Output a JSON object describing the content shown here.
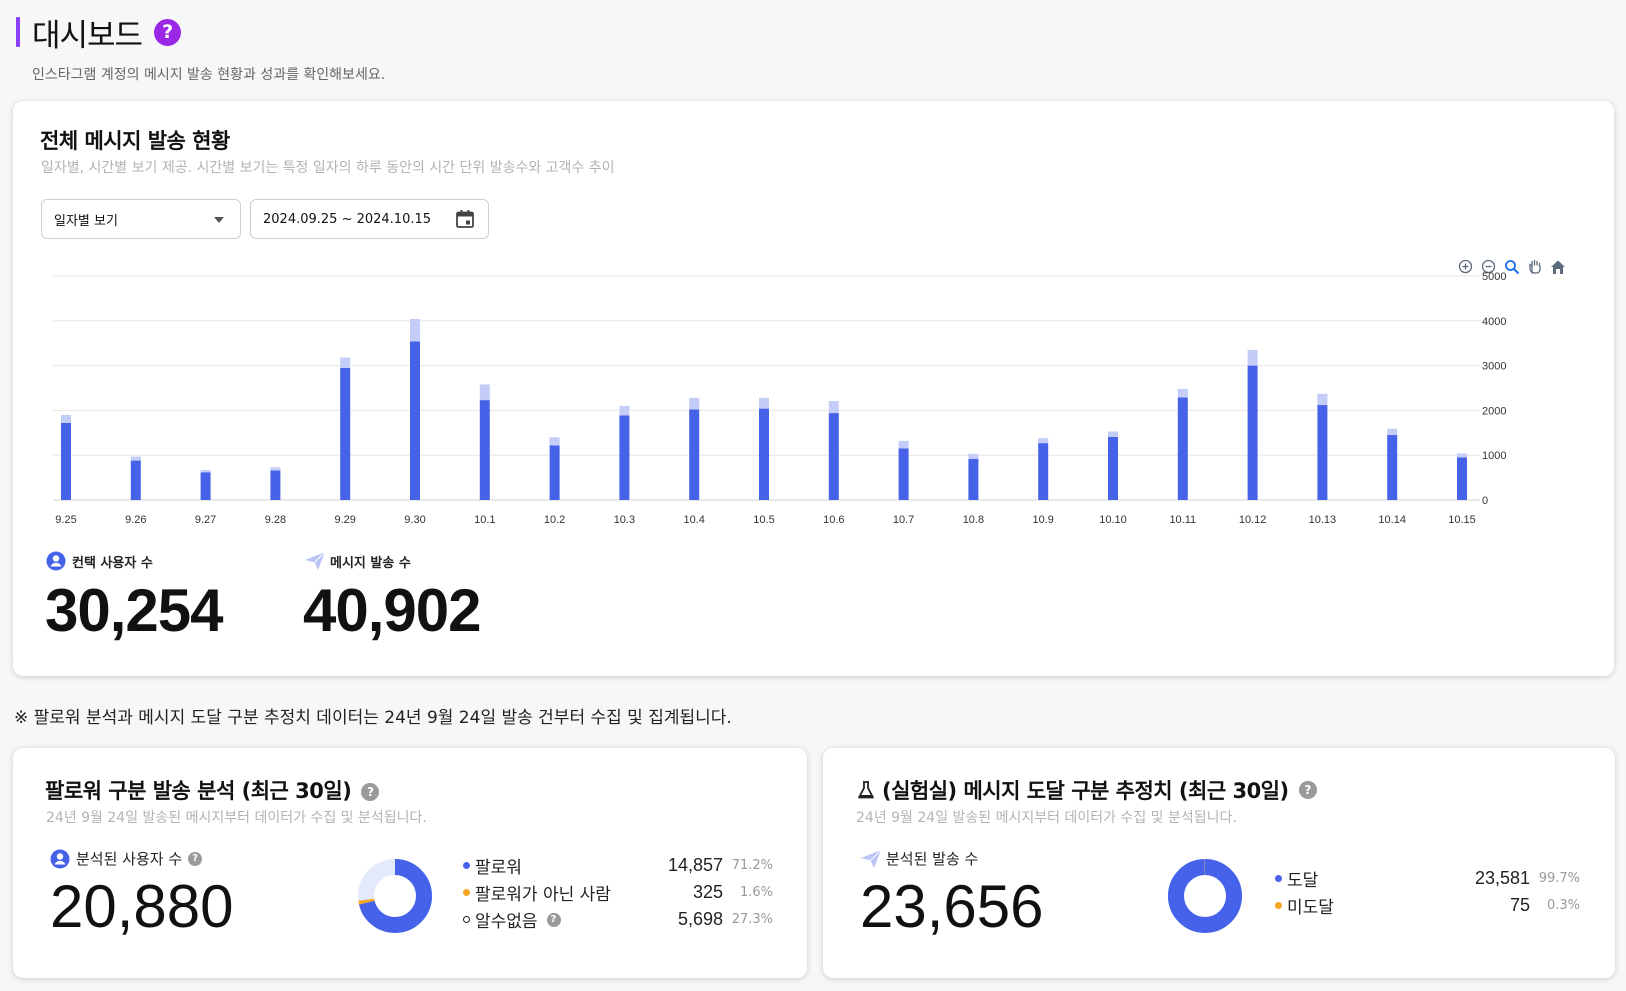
{
  "header": {
    "title": "대시보드",
    "help_icon": "question-circle-icon",
    "subtitle": "인스타그램 계정의 메시지 발송 현황과 성과를 확인해보세요."
  },
  "main_card": {
    "title": "전체 메시지 발송 현황",
    "description": "일자별, 시간별 보기 제공. 시간별 보기는 특정 일자의 하루 동안의 시간 단위 발송수와 고객수 추이",
    "view_select": {
      "value": "일자별 보기"
    },
    "date_range": {
      "value": "2024.09.25 ~ 2024.10.15"
    },
    "toolbar_icons": [
      "zoom-in-icon",
      "zoom-out-icon",
      "zoom-select-icon",
      "pan-hand-icon",
      "home-reset-icon"
    ],
    "kpis": [
      {
        "label": "컨택 사용자 수",
        "value": "30,254",
        "icon": "user-circle-icon"
      },
      {
        "label": "메시지 발송 수",
        "value": "40,902",
        "icon": "paper-plane-icon"
      }
    ]
  },
  "chart_data": {
    "type": "bar",
    "stacked": true,
    "categories": [
      "9.25",
      "9.26",
      "9.27",
      "9.28",
      "9.29",
      "9.30",
      "10.1",
      "10.2",
      "10.3",
      "10.4",
      "10.5",
      "10.6",
      "10.7",
      "10.8",
      "10.9",
      "10.10",
      "10.11",
      "10.12",
      "10.13",
      "10.14",
      "10.15"
    ],
    "series": [
      {
        "color": "#4662e8",
        "values": [
          1720,
          880,
          620,
          660,
          2950,
          3540,
          2230,
          1220,
          1890,
          2020,
          2040,
          1940,
          1150,
          920,
          1270,
          1410,
          2290,
          3000,
          2120,
          1450,
          950
        ]
      },
      {
        "color": "#c3cdf8",
        "values": [
          180,
          90,
          50,
          70,
          230,
          500,
          350,
          180,
          210,
          260,
          240,
          270,
          170,
          110,
          110,
          120,
          190,
          350,
          250,
          140,
          90
        ]
      }
    ],
    "ylim": [
      0,
      5000
    ],
    "yticks": [
      0,
      1000,
      2000,
      3000,
      4000,
      5000
    ],
    "y_axis_side": "right",
    "grid": true
  },
  "notice": "※ 팔로워 분석과 메시지 도달 구분 추정치 데이터는 24년 9월 24일 발송 건부터 수집 및 집계됩니다.",
  "follower_card": {
    "title": "팔로워 구분 발송 분석 (최근 30일)",
    "description": "24년 9월 24일 발송된 메시지부터 데이터가 수집 및 분석됩니다.",
    "metric_label": "분석된 사용자 수",
    "metric_value": "20,880",
    "legend": [
      {
        "label": "팔로워",
        "value": "14,857",
        "pct": "71.2%",
        "color": "#4662e8",
        "share": 0.712
      },
      {
        "label": "팔로워가 아닌 사람",
        "value": "325",
        "pct": "1.6%",
        "color": "#f5a623",
        "share": 0.016
      },
      {
        "label": "알수없음",
        "value": "5,698",
        "pct": "27.3%",
        "color": "#e4e9fb",
        "share": 0.273
      }
    ]
  },
  "delivery_card": {
    "title": "(실험실) 메시지 도달 구분 추정치 (최근 30일)",
    "title_icon": "flask-icon",
    "description": "24년 9월 24일 발송된 메시지부터 데이터가 수집 및 분석됩니다.",
    "metric_label": "분석된 발송 수",
    "metric_value": "23,656",
    "legend": [
      {
        "label": "도달",
        "value": "23,581",
        "pct": "99.7%",
        "color": "#4662e8",
        "share": 0.997
      },
      {
        "label": "미도달",
        "value": "75",
        "pct": "0.3%",
        "color": "#f5a623",
        "share": 0.003
      }
    ]
  }
}
